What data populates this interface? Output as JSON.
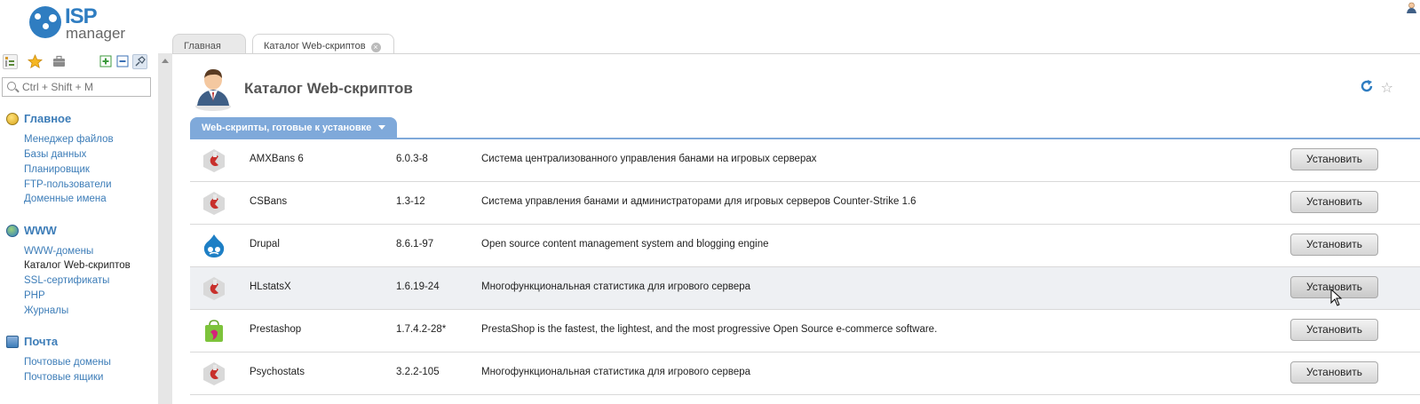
{
  "logo": {
    "brand": "ISP",
    "product": "manager"
  },
  "search": {
    "placeholder": "Ctrl + Shift + M"
  },
  "sidebar": {
    "sections": [
      {
        "title": "Главное",
        "items": [
          "Менеджер файлов",
          "Базы данных",
          "Планировщик",
          "FTP-пользователи",
          "Доменные имена"
        ]
      },
      {
        "title": "WWW",
        "items": [
          "WWW-домены",
          "Каталог Web-скриптов",
          "SSL-сертификаты",
          "PHP",
          "Журналы"
        ]
      },
      {
        "title": "Почта",
        "items": [
          "Почтовые домены",
          "Почтовые ящики"
        ]
      }
    ]
  },
  "tabs": [
    {
      "label": "Главная"
    },
    {
      "label": "Каталог Web-скриптов"
    }
  ],
  "page": {
    "title": "Каталог Web-скриптов",
    "subtab": "Web-скрипты, готовые к установке"
  },
  "scripts": [
    {
      "name": "AMXBans 6",
      "version": "6.0.3-8",
      "description": "Система централизованного управления банами на игровых серверах",
      "icon": "game-icon",
      "action": "Установить"
    },
    {
      "name": "CSBans",
      "version": "1.3-12",
      "description": "Система управления банами и администраторами для игровых серверов Counter-Strike 1.6",
      "icon": "game-icon",
      "action": "Установить"
    },
    {
      "name": "Drupal",
      "version": "8.6.1-97",
      "description": "Open source content management system and blogging engine",
      "icon": "drupal-icon",
      "action": "Установить"
    },
    {
      "name": "HLstatsX",
      "version": "1.6.19-24",
      "description": "Многофункциональная статистика для игрового сервера",
      "icon": "game-icon",
      "action": "Установить"
    },
    {
      "name": "Prestashop",
      "version": "1.7.4.2-28*",
      "description": "PrestaShop is the fastest, the lightest, and the most progressive Open Source e-commerce software.",
      "icon": "shop-bag-icon",
      "action": "Установить"
    },
    {
      "name": "Psychostats",
      "version": "3.2.2-105",
      "description": "Многофункциональная статистика для игрового сервера",
      "icon": "game-icon",
      "action": "Установить"
    }
  ],
  "colors": {
    "accent": "#3d7db8",
    "subtab": "#7fa9da",
    "brand": "#2f7dc1"
  }
}
